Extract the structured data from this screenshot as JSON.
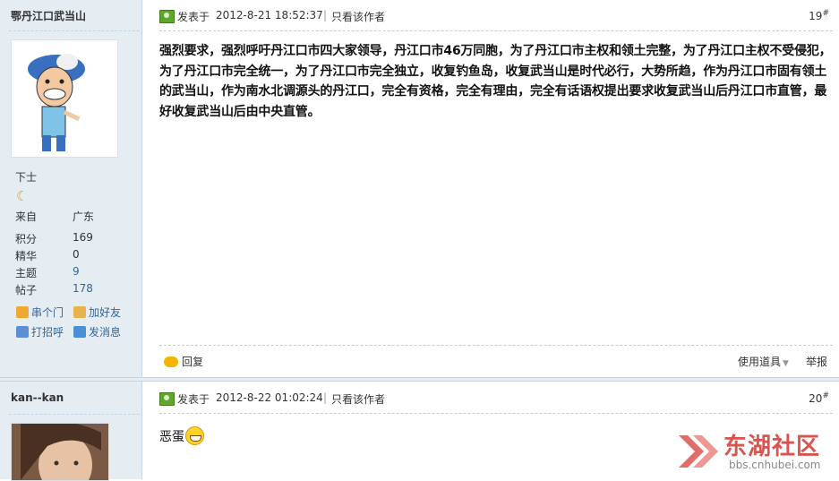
{
  "post1": {
    "author": "鄂丹江口武当山",
    "rank": "下士",
    "from_label": "来自",
    "from_value": "广东",
    "stats": [
      {
        "label": "积分",
        "value": "169"
      },
      {
        "label": "精华",
        "value": "0"
      },
      {
        "label": "主题",
        "value": "9"
      },
      {
        "label": "帖子",
        "value": "178"
      }
    ],
    "actions": {
      "visit": "串个门",
      "add_friend": "加好友",
      "greet": "打招呼",
      "message": "发消息"
    },
    "posted_label": "发表于",
    "time": "2012-8-21 18:52:37",
    "only_author": "只看该作者",
    "floor": "19",
    "floor_mark": "#",
    "content": "强烈要求，强烈呼吁丹江口市四大家领导，丹江口市46万同胞，为了丹江口市主权和领土完整，为了丹江口主权不受侵犯，为了丹江口市完全统一，为了丹江口市完全独立，收复钓鱼岛，收复武当山是时代必行，大势所趋，作为丹江口市固有领土的武当山，作为南水北调源头的丹江口，完全有资格，完全有理由，完全有话语权提出要求收复武当山后丹江口市直管，最好收复武当山后由中央直管。",
    "reply": "回复",
    "tools": "使用道具",
    "report": "举报"
  },
  "post2": {
    "author": "kan--kan",
    "posted_label": "发表于",
    "time": "2012-8-22 01:02:24",
    "only_author": "只看该作者",
    "floor": "20",
    "floor_mark": "#",
    "content": "恶蛋"
  },
  "watermark": {
    "name": "东湖社区",
    "url": "bbs.cnhubei.com"
  },
  "colors": {
    "sidebar_bg": "#e5edf2",
    "link": "#336699",
    "logo_red": "#d9534f"
  }
}
